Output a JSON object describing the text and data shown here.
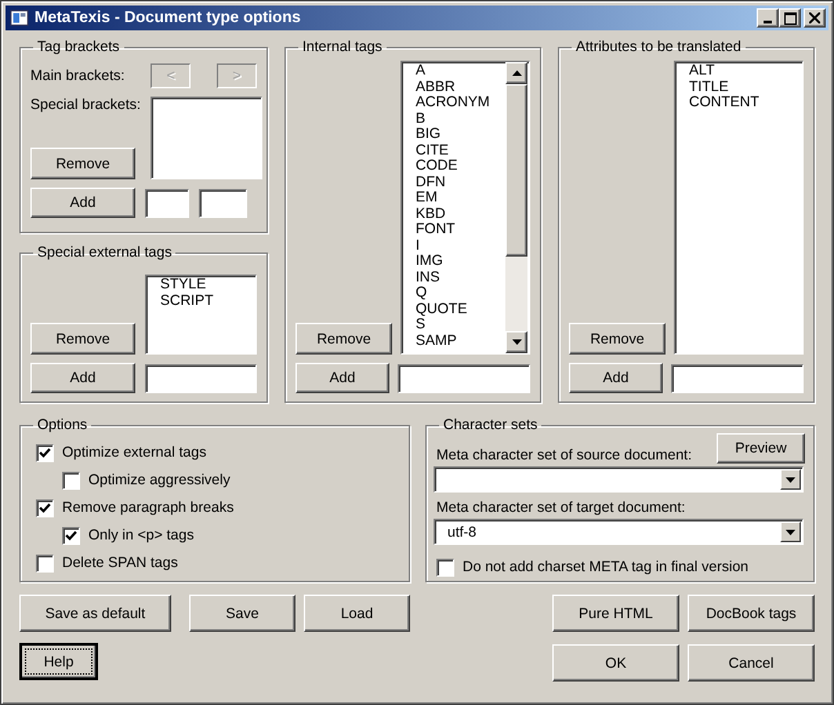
{
  "window": {
    "title": "MetaTexis - Document type options"
  },
  "tag_brackets": {
    "title": "Tag brackets",
    "main_label": "Main brackets:",
    "main_buttons": [
      {
        "label": "<",
        "disabled": true
      },
      {
        "label": ">",
        "disabled": true
      }
    ],
    "special_label": "Special brackets:",
    "remove": "Remove",
    "add": "Add"
  },
  "special_external_tags": {
    "title": "Special external tags",
    "items": [
      "STYLE",
      "SCRIPT"
    ],
    "remove": "Remove",
    "add": "Add"
  },
  "internal_tags": {
    "title": "Internal tags",
    "items": [
      "A",
      "ABBR",
      "ACRONYM",
      "B",
      "BIG",
      "CITE",
      "CODE",
      "DFN",
      "EM",
      "KBD",
      "FONT",
      "I",
      "IMG",
      "INS",
      "Q",
      "QUOTE",
      "S",
      "SAMP"
    ],
    "remove": "Remove",
    "add": "Add"
  },
  "attributes": {
    "title": "Attributes to be translated",
    "items": [
      "ALT",
      "TITLE",
      "CONTENT"
    ],
    "remove": "Remove",
    "add": "Add"
  },
  "options": {
    "title": "Options",
    "items": [
      {
        "label": "Optimize external tags",
        "checked": true,
        "children": [
          {
            "label": "Optimize aggressively",
            "checked": false
          }
        ]
      },
      {
        "label": "Remove paragraph breaks",
        "checked": true,
        "children": [
          {
            "label": "Only in <p> tags",
            "checked": true
          }
        ]
      },
      {
        "label": "Delete SPAN tags",
        "checked": false
      }
    ]
  },
  "character_sets": {
    "title": "Character sets",
    "source_label": "Meta character set of source document:",
    "preview": "Preview",
    "target_label": "Meta character set of target document:",
    "target_value": "utf-8",
    "no_meta": {
      "label": "Do not add charset META tag in final version",
      "checked": false
    }
  },
  "buttons_left": [
    "Save as default",
    "Save",
    "Load"
  ],
  "buttons_right": [
    "Pure HTML",
    "DocBook tags"
  ],
  "help": {
    "label": "Help",
    "focused": true
  },
  "dialog_buttons": [
    "OK",
    "Cancel"
  ]
}
